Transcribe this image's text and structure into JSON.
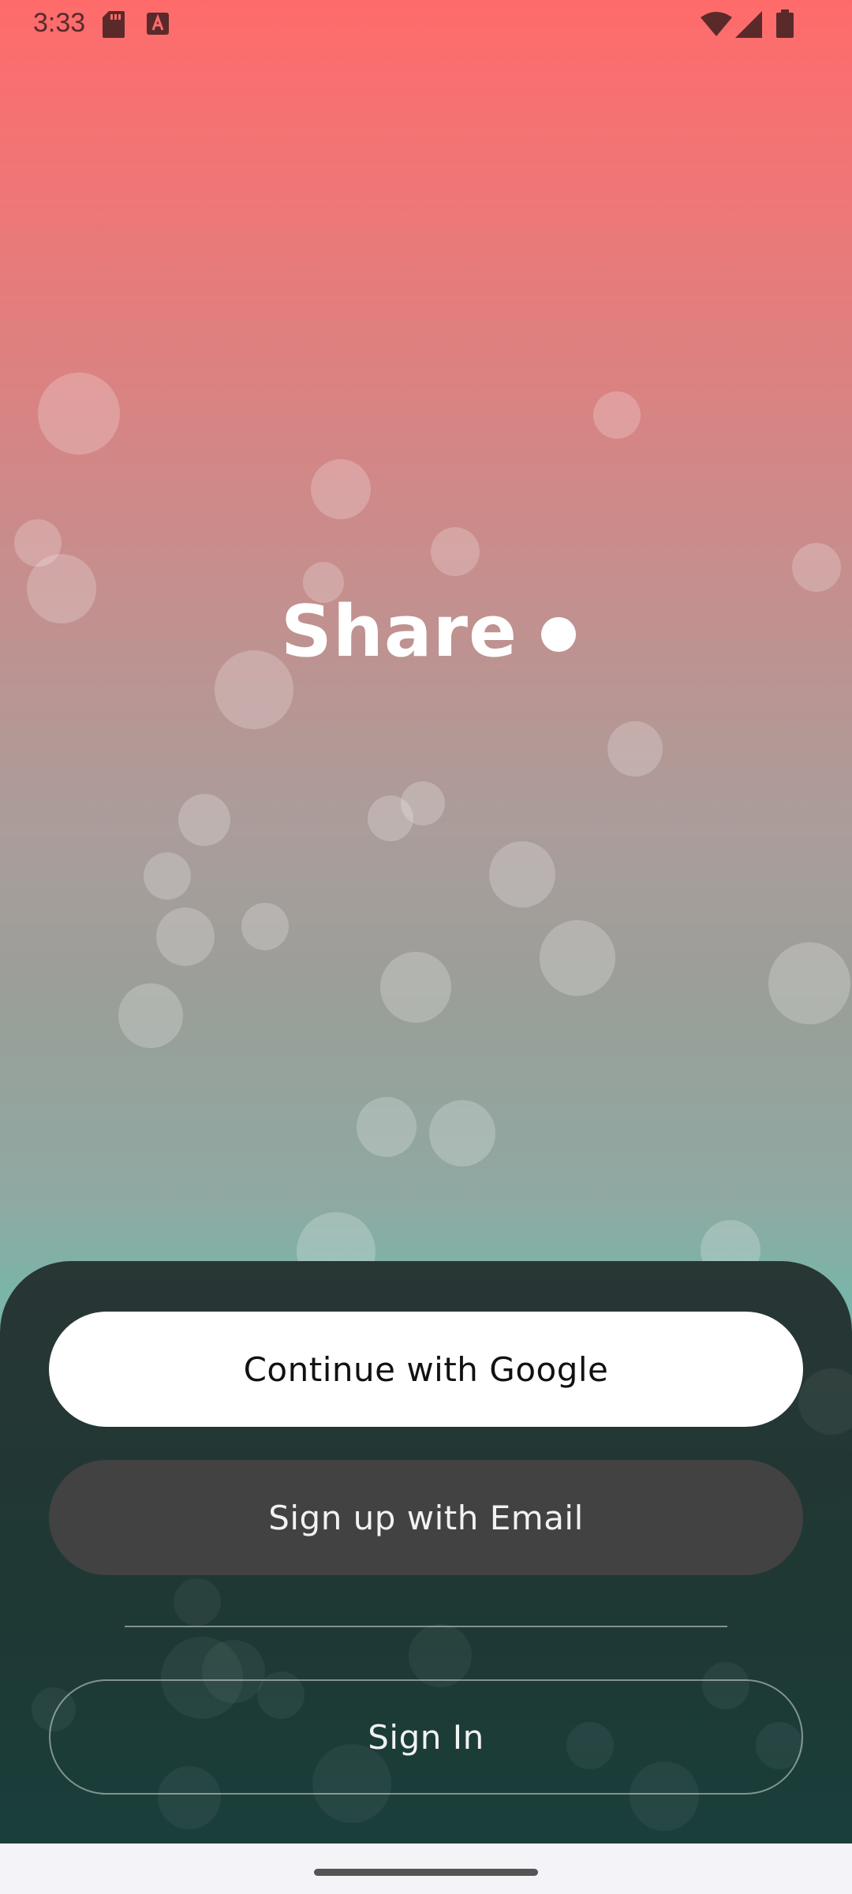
{
  "status_bar": {
    "time": "3:33",
    "icons": [
      "sd-card-icon",
      "a-text-icon",
      "wifi-icon",
      "signal-icon",
      "battery-icon"
    ]
  },
  "logo": {
    "text": "Share"
  },
  "auth": {
    "google_label": "Continue with Google",
    "email_label": "Sign up with Email",
    "signin_label": "Sign In"
  },
  "colors": {
    "gradient_top": "#ff6b6b",
    "gradient_bottom": "#7bb4a8",
    "panel": "#1e3834",
    "email_button": "#424242"
  }
}
